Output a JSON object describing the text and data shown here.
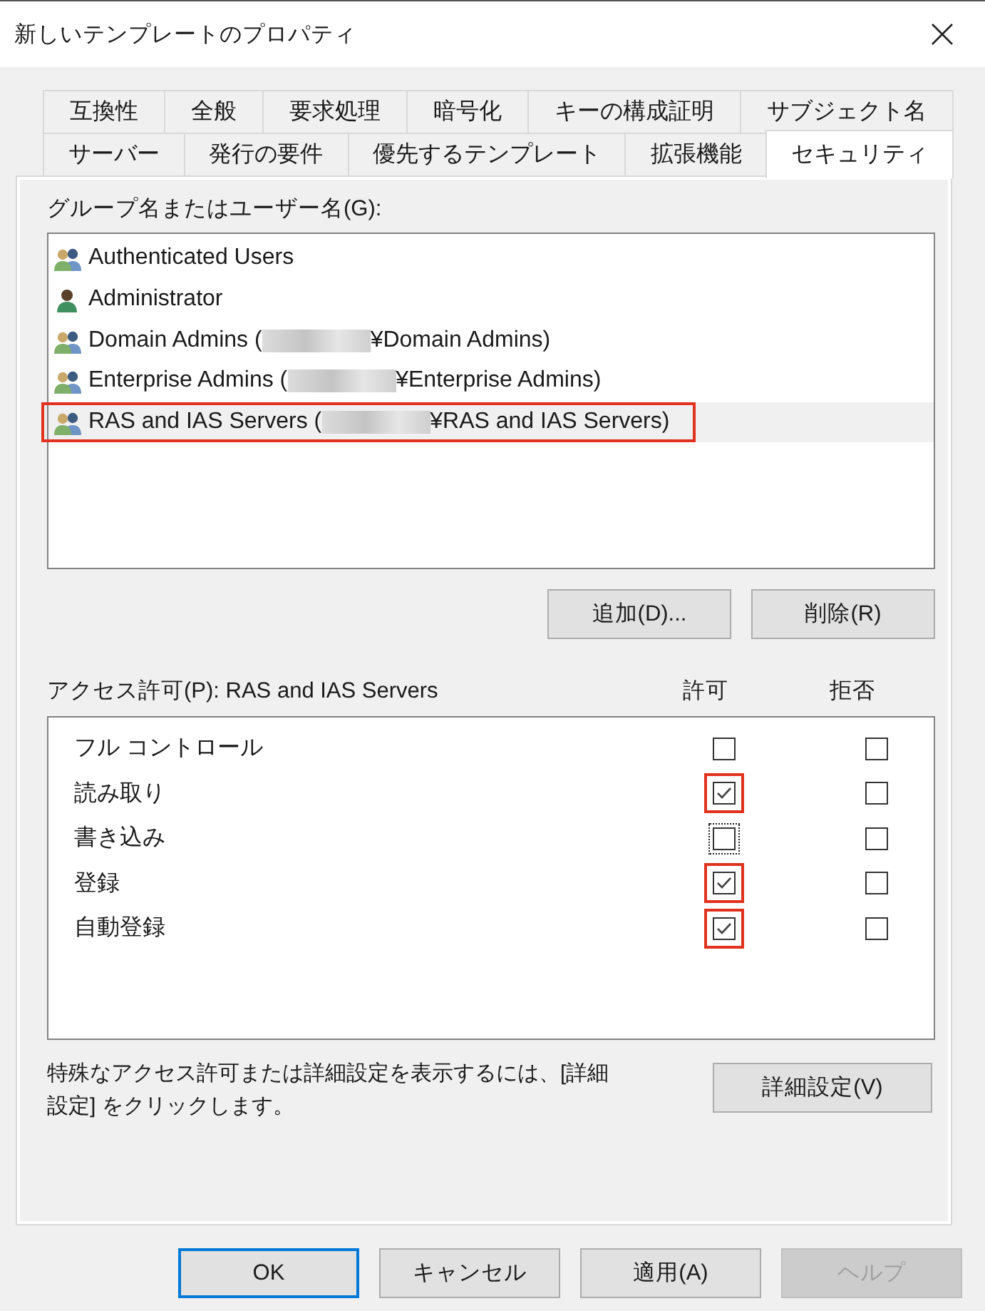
{
  "window": {
    "title": "新しいテンプレートのプロパティ"
  },
  "tab_rows": [
    [
      {
        "label": "互換性",
        "selected": false
      },
      {
        "label": "全般",
        "selected": false
      },
      {
        "label": "要求処理",
        "selected": false
      },
      {
        "label": "暗号化",
        "selected": false
      },
      {
        "label": "キーの構成証明",
        "selected": false
      },
      {
        "label": "サブジェクト名",
        "selected": false
      }
    ],
    [
      {
        "label": "サーバー",
        "selected": false
      },
      {
        "label": "発行の要件",
        "selected": false
      },
      {
        "label": "優先するテンプレート",
        "selected": false
      },
      {
        "label": "拡張機能",
        "selected": false
      },
      {
        "label": "セキュリティ",
        "selected": true
      }
    ]
  ],
  "users": {
    "label": "グループ名またはユーザー名(G):",
    "items": [
      {
        "kind": "group",
        "name": "Authenticated Users",
        "selected": false,
        "highlighted": false
      },
      {
        "kind": "user",
        "name": "Administrator",
        "selected": false,
        "highlighted": false
      },
      {
        "kind": "group",
        "name": "Domain Admins (",
        "after_redaction": "¥Domain Admins)",
        "selected": false,
        "highlighted": false
      },
      {
        "kind": "group",
        "name": "Enterprise Admins (",
        "after_redaction": "¥Enterprise Admins)",
        "selected": false,
        "highlighted": false
      },
      {
        "kind": "group",
        "name": "RAS and IAS Servers (",
        "after_redaction": "¥RAS and IAS Servers)",
        "selected": true,
        "highlighted": true
      }
    ],
    "buttons": [
      "追加(D)...",
      "削除(R)"
    ]
  },
  "permissions": {
    "label": "アクセス許可(P): RAS and IAS Servers",
    "columns": [
      "許可",
      "拒否"
    ],
    "rows": [
      {
        "name": "フル コントロール",
        "allow": false,
        "deny": false,
        "highlighted": false,
        "focused": false
      },
      {
        "name": "読み取り",
        "allow": true,
        "deny": false,
        "highlighted": true,
        "focused": false
      },
      {
        "name": "書き込み",
        "allow": false,
        "deny": false,
        "highlighted": false,
        "focused": true
      },
      {
        "name": "登録",
        "allow": true,
        "deny": false,
        "highlighted": true,
        "focused": false
      },
      {
        "name": "自動登録",
        "allow": true,
        "deny": false,
        "highlighted": true,
        "focused": false
      }
    ]
  },
  "hint": "特殊なアクセス許可または詳細設定を表示するには、[詳細設定] をクリックします。",
  "advanced_button": "詳細設定(V)",
  "dialog_buttons": [
    {
      "label": "OK",
      "default": true,
      "disabled": false
    },
    {
      "label": "キャンセル",
      "default": false,
      "disabled": false
    },
    {
      "label": "適用(A)",
      "default": false,
      "disabled": false
    },
    {
      "label": "ヘルプ",
      "default": false,
      "disabled": true
    }
  ]
}
